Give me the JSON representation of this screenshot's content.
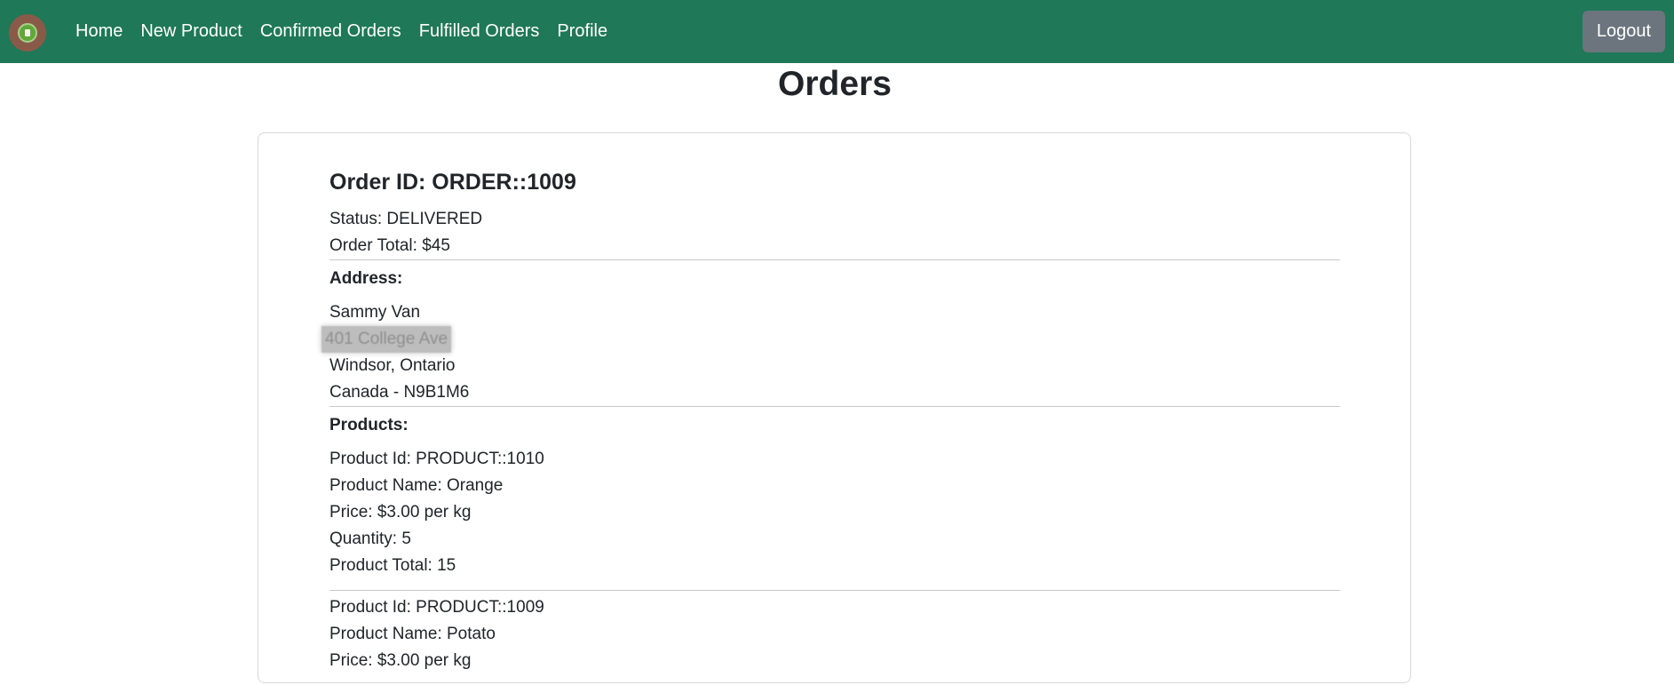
{
  "navbar": {
    "links": [
      "Home",
      "New Product",
      "Confirmed Orders",
      "Fulfilled Orders",
      "Profile"
    ],
    "logout_label": "Logout",
    "background": "#1f7858"
  },
  "page": {
    "title": "Orders"
  },
  "order": {
    "id_line": "Order ID: ORDER::1009",
    "status_line": "Status: DELIVERED",
    "total_line": "Order Total: $45",
    "address_heading": "Address:",
    "address": {
      "name": "Sammy Van",
      "street": "401 College Ave",
      "city": "Windsor, Ontario",
      "country": "Canada - N9B1M6"
    },
    "products_heading": "Products:",
    "products": [
      {
        "id": "Product Id: PRODUCT::1010",
        "name": "Product Name: Orange",
        "price": "Price: $3.00 per kg",
        "quantity": "Quantity: 5",
        "total": "Product Total: 15"
      },
      {
        "id": "Product Id: PRODUCT::1009",
        "name": "Product Name: Potato",
        "price": "Price: $3.00 per kg"
      }
    ]
  }
}
